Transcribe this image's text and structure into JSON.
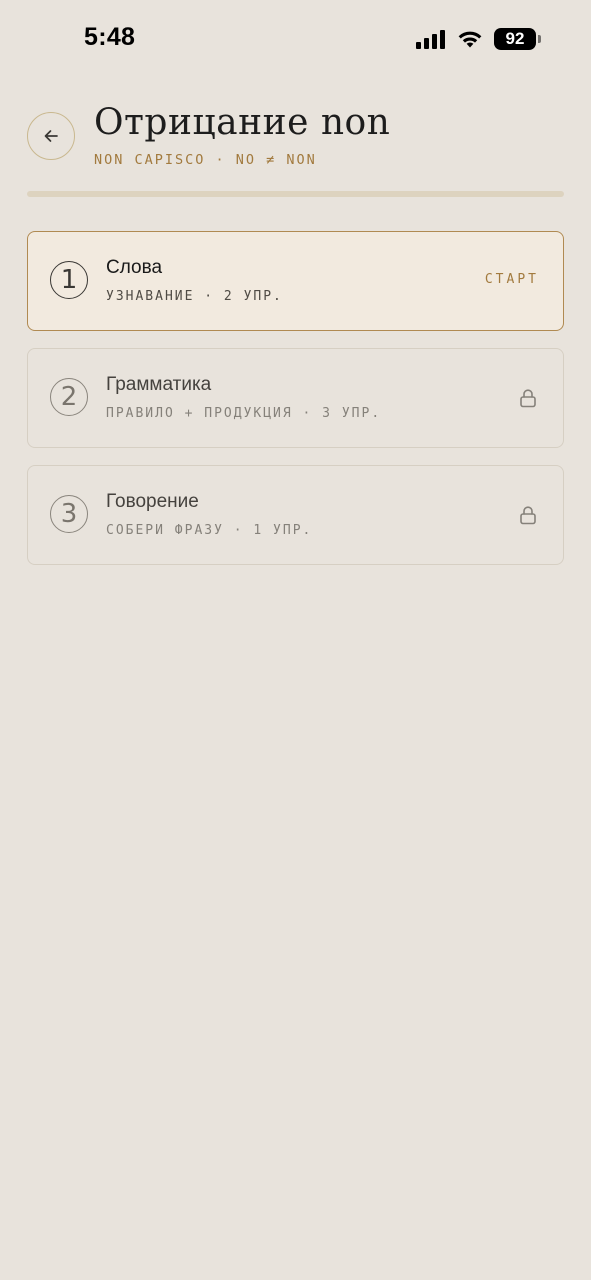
{
  "status_bar": {
    "time": "5:48",
    "battery": "92",
    "icons": [
      "cellular-signal-icon",
      "wifi-icon",
      "battery-icon"
    ]
  },
  "header": {
    "back_icon": "arrow-left-icon",
    "title": "Отрицание non",
    "subtitle": "NON CAPISCO · NO ≠ NON"
  },
  "lessons": [
    {
      "number": "1",
      "title": "Слова",
      "meta": "УЗНАВАНИЕ · 2 УПР.",
      "action": "СТАРТ",
      "state": "active"
    },
    {
      "number": "2",
      "title": "Грамматика",
      "meta": "ПРАВИЛО + ПРОДУКЦИЯ · 3 УПР.",
      "state": "locked",
      "icon": "lock-icon"
    },
    {
      "number": "3",
      "title": "Говорение",
      "meta": "СОБЕРИ ФРАЗУ · 1 УПР.",
      "state": "locked",
      "icon": "lock-icon"
    }
  ],
  "colors": {
    "background": "#e8e3dc",
    "accent": "#a27a3e",
    "active_card_bg": "#f2eadf",
    "active_card_border": "#b08a52"
  }
}
